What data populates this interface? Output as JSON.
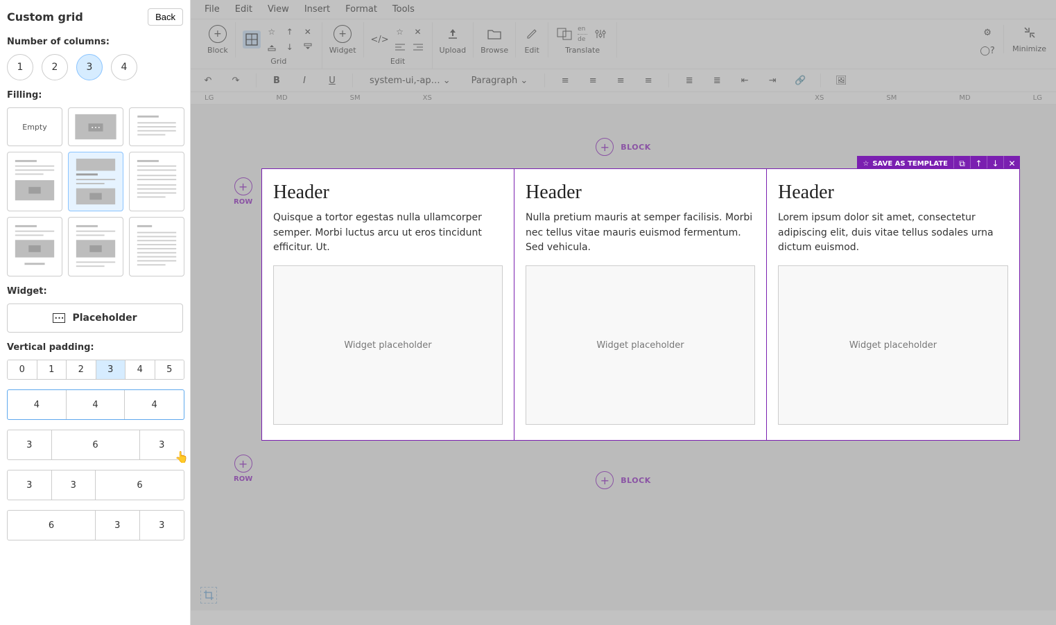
{
  "sidebar": {
    "title": "Custom grid",
    "back": "Back",
    "columns_label": "Number of columns:",
    "columns": [
      "1",
      "2",
      "3",
      "4"
    ],
    "columns_selected": "3",
    "filling_label": "Filling:",
    "filling_empty": "Empty",
    "widget_label": "Widget:",
    "widget_value": "Placeholder",
    "vp_label": "Vertical padding:",
    "vp_options": [
      "0",
      "1",
      "2",
      "3",
      "4",
      "5"
    ],
    "vp_selected": "3",
    "layouts": [
      {
        "cells": [
          "4",
          "4",
          "4"
        ],
        "widths": [
          4,
          4,
          4
        ],
        "selected": true
      },
      {
        "cells": [
          "3",
          "6",
          "3"
        ],
        "widths": [
          3,
          6,
          3
        ],
        "selected": false
      },
      {
        "cells": [
          "3",
          "3",
          "6"
        ],
        "widths": [
          3,
          3,
          6
        ],
        "selected": false
      },
      {
        "cells": [
          "6",
          "3",
          "3"
        ],
        "widths": [
          6,
          3,
          3
        ],
        "selected": false
      }
    ]
  },
  "menubar": [
    "File",
    "Edit",
    "View",
    "Insert",
    "Format",
    "Tools"
  ],
  "toolbar": {
    "block": "Block",
    "grid": "Grid",
    "widget": "Widget",
    "edit": "Edit",
    "upload": "Upload",
    "browse": "Browse",
    "edit2": "Edit",
    "translate": "Translate",
    "minimize": "Minimize",
    "lang1": "en",
    "lang2": "de"
  },
  "format_row": {
    "font": "system-ui,-ap…",
    "style": "Paragraph"
  },
  "breakpoints_left": [
    "LG",
    "MD",
    "SM",
    "XS"
  ],
  "breakpoints_right": [
    "XS",
    "SM",
    "MD",
    "LG"
  ],
  "canvas": {
    "block_label": "BLOCK",
    "row_label": "ROW",
    "save_template": "SAVE AS TEMPLATE",
    "columns": [
      {
        "header": "Header",
        "text": "Quisque a tortor egestas nulla ullamcorper semper. Morbi luctus arcu ut eros tincidunt efficitur. Ut.",
        "placeholder": "Widget placeholder"
      },
      {
        "header": "Header",
        "text": "Nulla pretium mauris at semper facilisis. Morbi nec tellus vitae mauris euismod fermentum. Sed vehicula.",
        "placeholder": "Widget placeholder"
      },
      {
        "header": "Header",
        "text": "Lorem ipsum dolor sit amet, consectetur adipiscing elit, duis vitae tellus sodales urna dictum euismod.",
        "placeholder": "Widget placeholder"
      }
    ]
  }
}
